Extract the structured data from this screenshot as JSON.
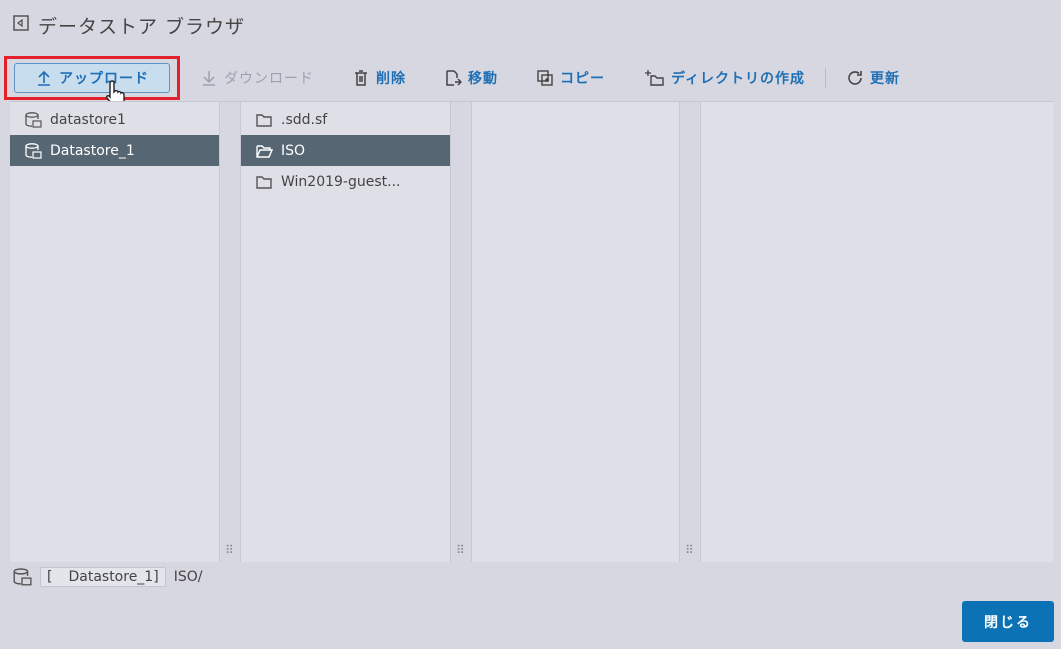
{
  "window": {
    "title": "データストア ブラウザ"
  },
  "toolbar": {
    "upload": "アップロード",
    "download": "ダウンロード",
    "delete": "削除",
    "move": "移動",
    "copy": "コピー",
    "mkdir": "ディレクトリの作成",
    "refresh": "更新"
  },
  "datastores": [
    {
      "name": "datastore1",
      "selected": false
    },
    {
      "name": "Datastore_1",
      "selected": true
    }
  ],
  "folders": [
    {
      "name": ".sdd.sf",
      "selected": false
    },
    {
      "name": "ISO",
      "selected": true
    },
    {
      "name": "Win2019-guest...",
      "selected": false
    }
  ],
  "path": {
    "bracket": "[",
    "datastore": "Datastore_1]",
    "folder": "ISO/"
  },
  "footer": {
    "close": "閉じる"
  },
  "colors": {
    "accent": "#0b72b5",
    "selected_row": "#566673",
    "highlight": "#e4202b"
  }
}
